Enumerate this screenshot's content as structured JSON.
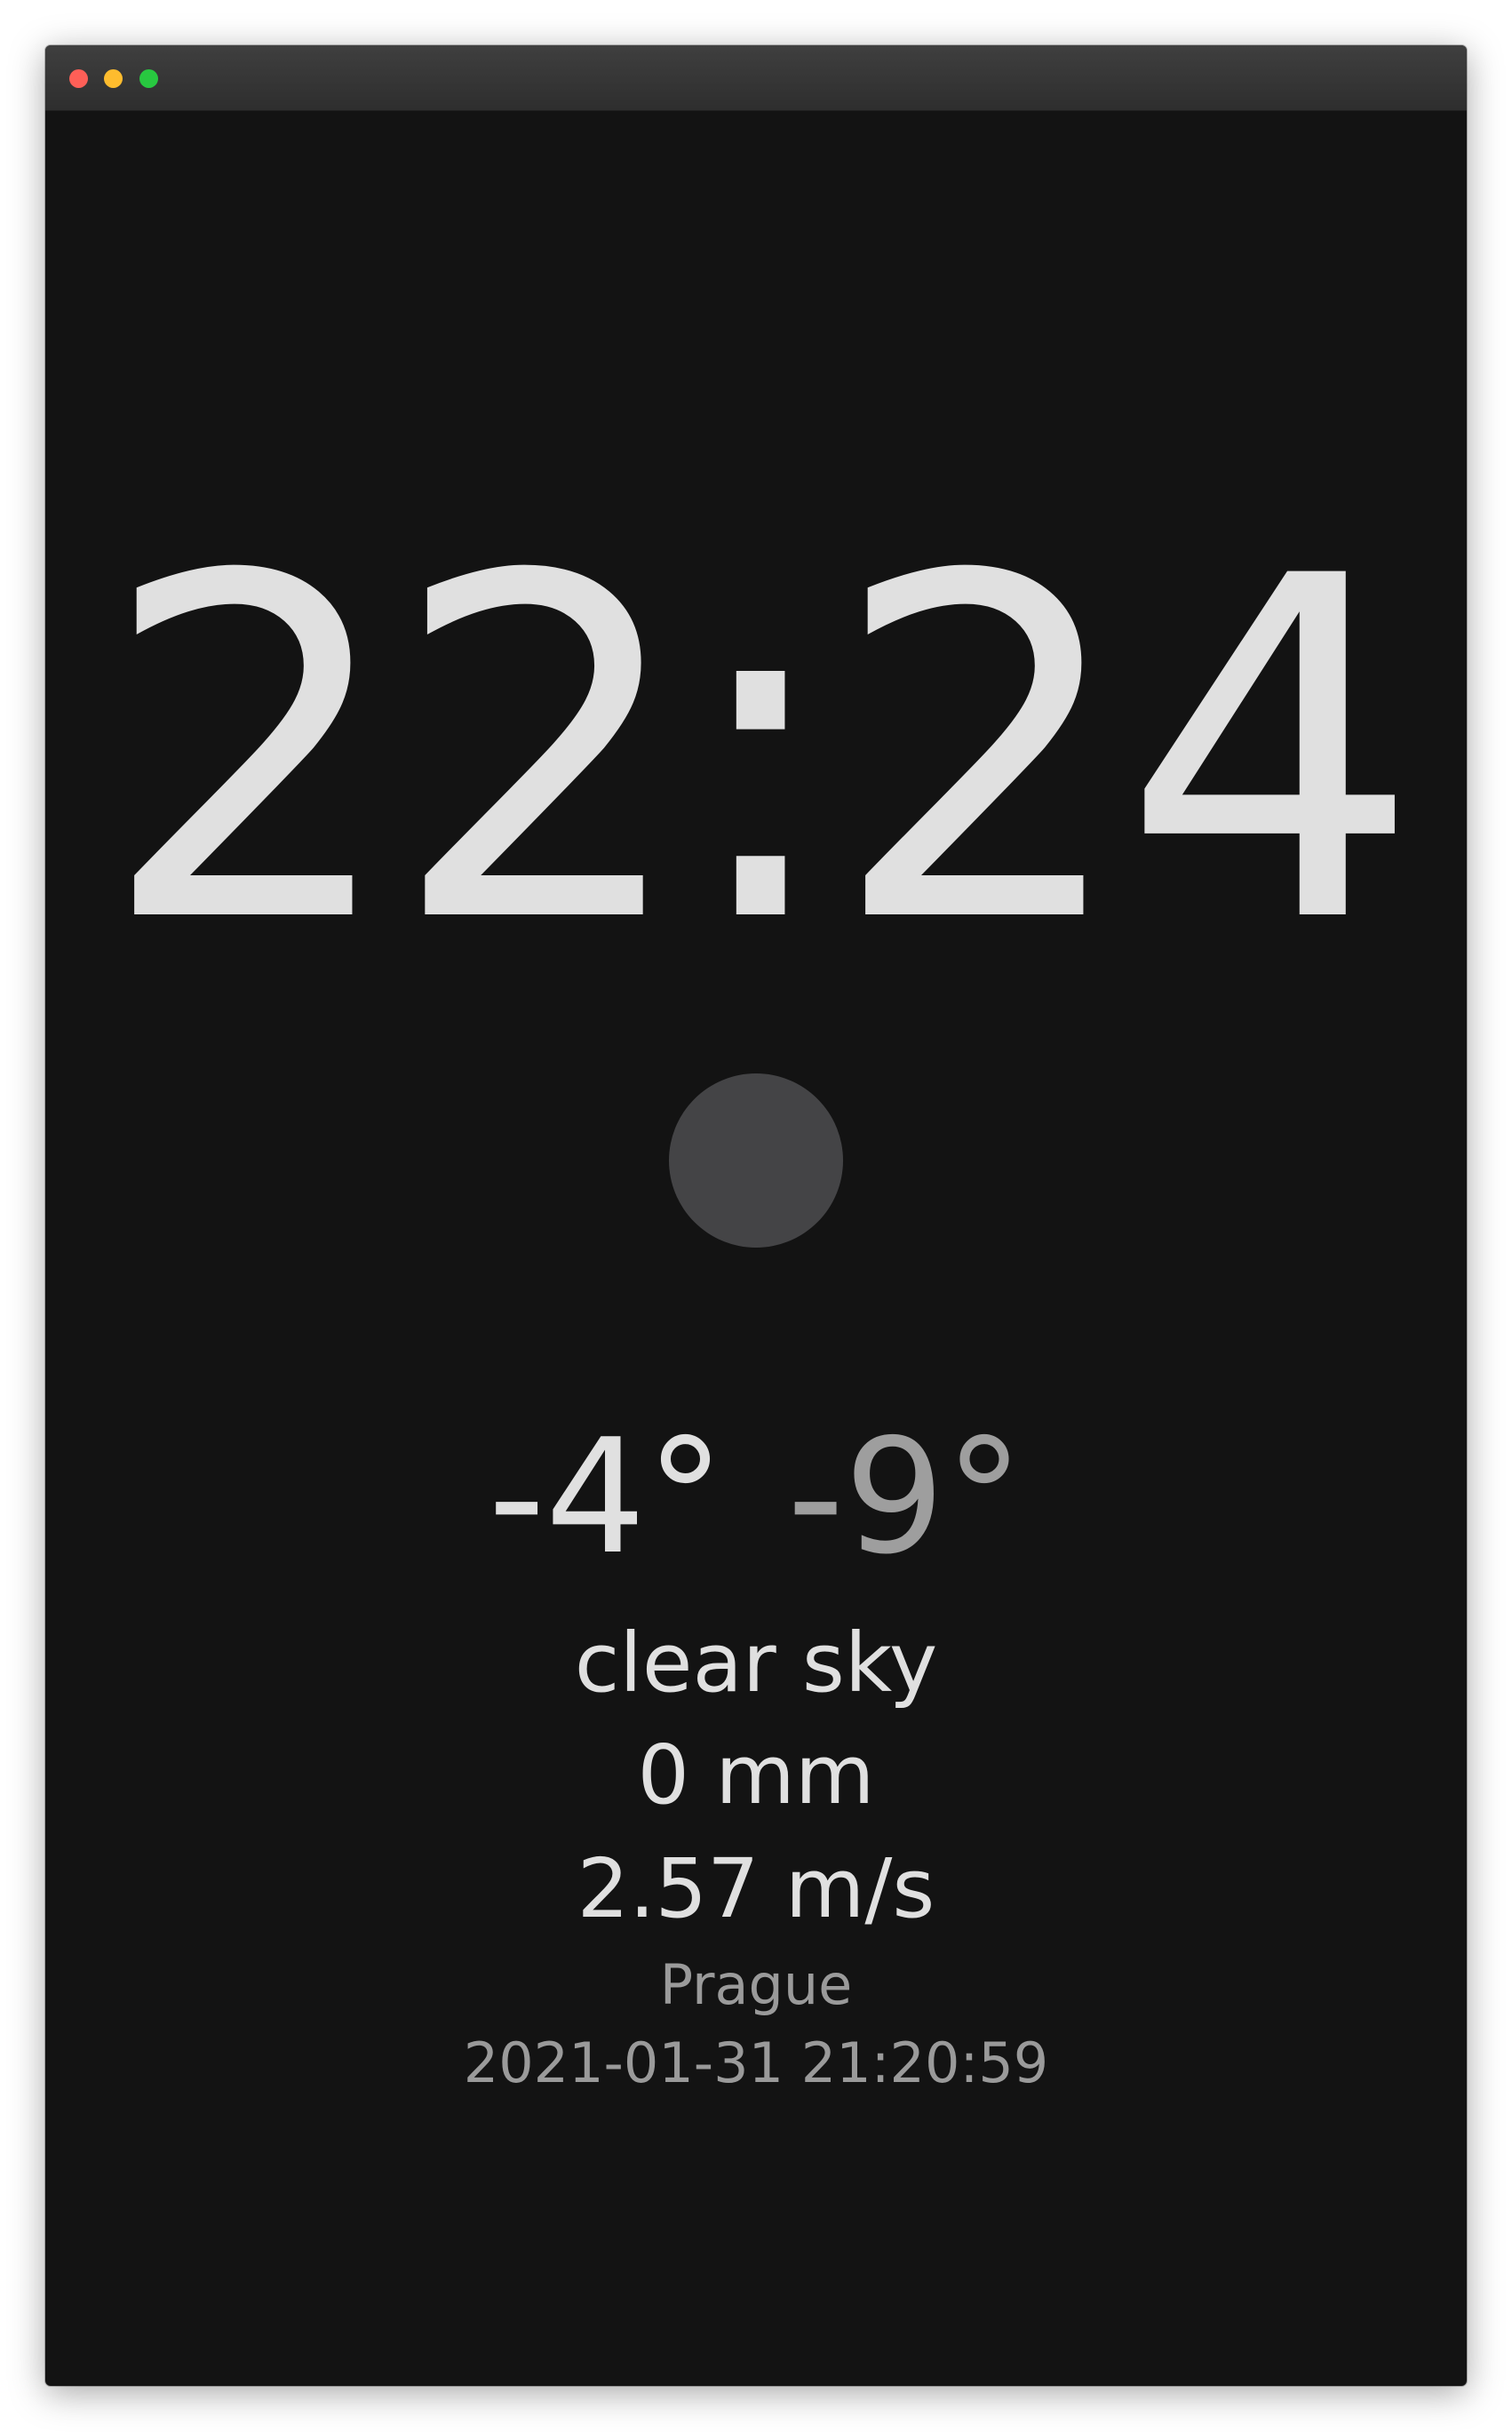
{
  "window": {
    "controls": [
      "close",
      "minimize",
      "zoom"
    ],
    "background": "#131313"
  },
  "clock": {
    "time": "22:24"
  },
  "weather": {
    "icon": "weather-icon-placeholder",
    "temperature": "-4°",
    "feels_like": "-9°",
    "description": "clear sky",
    "precipitation": "0 mm",
    "wind": "2.57 m/s",
    "city": "Prague",
    "updated": "2021-01-31 21:20:59"
  },
  "colors": {
    "primary_text": "#e0e0e0",
    "secondary_text": "#9e9e9e",
    "icon_fill": "#444446"
  }
}
